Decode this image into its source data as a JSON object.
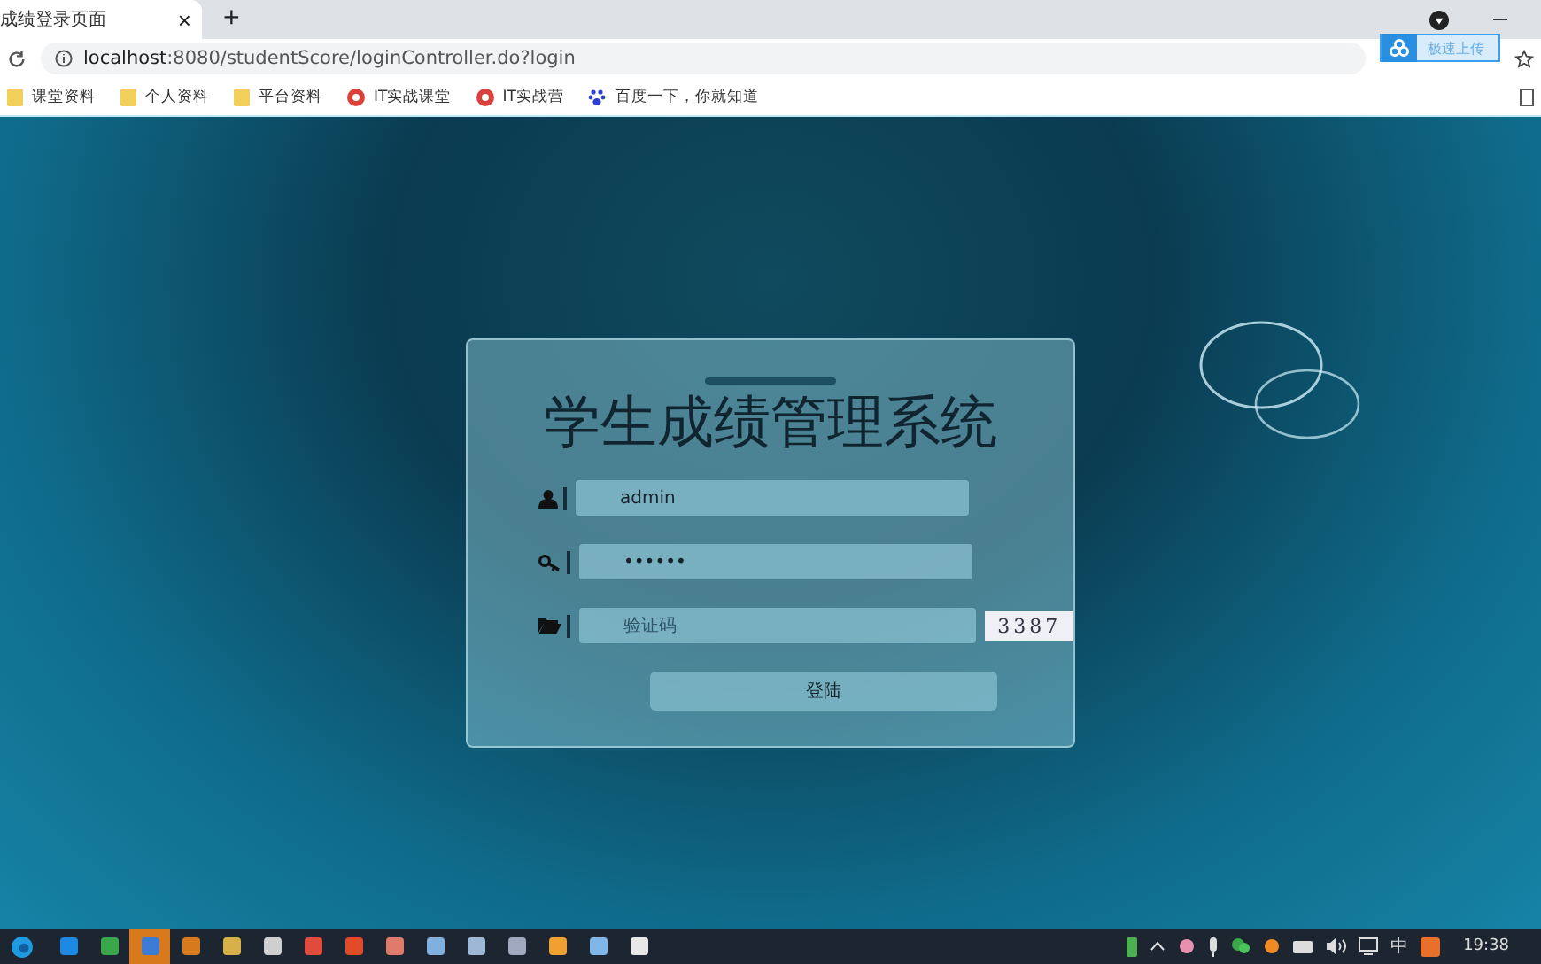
{
  "browser": {
    "tab": {
      "title": "成绩登录页面",
      "close": "×"
    },
    "new_tab": "+",
    "address": {
      "host": "localhost",
      "path": ":8080/studentScore/loginController.do?login"
    },
    "upload_button": "极速上传",
    "bookmarks": [
      {
        "label": "课堂资料",
        "kind": "folder"
      },
      {
        "label": "个人资料",
        "kind": "folder"
      },
      {
        "label": "平台资料",
        "kind": "folder"
      },
      {
        "label": "IT实战课堂",
        "kind": "site"
      },
      {
        "label": "IT实战营",
        "kind": "site"
      },
      {
        "label": "百度一下，你就知道",
        "kind": "paw"
      }
    ]
  },
  "login": {
    "title": "学生成绩管理系统",
    "fields": [
      {
        "kind": "user",
        "value": "admin"
      },
      {
        "kind": "key",
        "value": "••••••"
      },
      {
        "kind": "folder",
        "placeholder": "验证码",
        "captcha": "3387"
      }
    ],
    "submit": "登陆"
  },
  "taskbar": {
    "ime": "中",
    "clock": "19:38"
  }
}
